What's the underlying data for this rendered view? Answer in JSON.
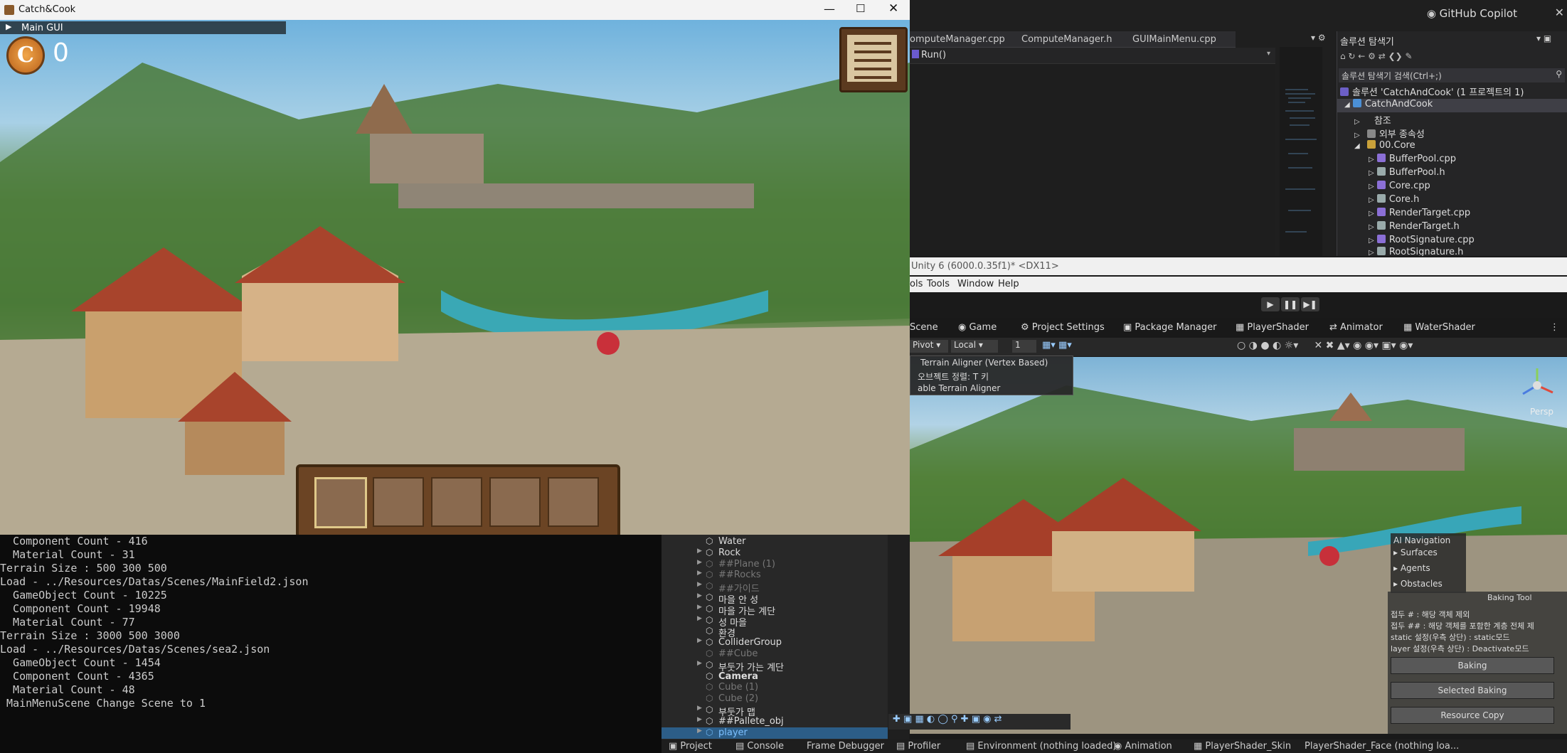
{
  "game_window": {
    "title": "Catch&Cook",
    "main_gui_label": "Main GUI",
    "coin_count": "0"
  },
  "console": {
    "lines": [
      "  Component Count - 416",
      "  Material Count - 31",
      "Terrain Size : 500 300 500",
      "Load - ../Resources/Datas/Scenes/MainField2.json",
      "  GameObject Count - 10225",
      "  Component Count - 19948",
      "  Material Count - 77",
      "Terrain Size : 3000 500 3000",
      "Load - ../Resources/Datas/Scenes/sea2.json",
      "  GameObject Count - 1454",
      "  Component Count - 4365",
      "  Material Count - 48",
      " MainMenuScene Change Scene to 1"
    ]
  },
  "hierarchy": {
    "items": [
      {
        "label": "Water",
        "dim": false,
        "arrow": false
      },
      {
        "label": "Rock",
        "dim": false,
        "arrow": true
      },
      {
        "label": "##Plane (1)",
        "dim": true,
        "arrow": true
      },
      {
        "label": "##Rocks",
        "dim": true,
        "arrow": true
      },
      {
        "label": "##가이드",
        "dim": true,
        "arrow": true
      },
      {
        "label": "마을 안 성",
        "dim": false,
        "arrow": true
      },
      {
        "label": "마을 가는 계단",
        "dim": false,
        "arrow": true
      },
      {
        "label": "성 마을",
        "dim": false,
        "arrow": true
      },
      {
        "label": "환경",
        "dim": false,
        "arrow": false
      },
      {
        "label": "ColliderGroup",
        "dim": false,
        "arrow": true
      },
      {
        "label": "##Cube",
        "dim": true,
        "arrow": false
      },
      {
        "label": "부둣가 가는 계단",
        "dim": false,
        "arrow": true
      },
      {
        "label": "Camera",
        "dim": false,
        "arrow": false
      },
      {
        "label": "Cube (1)",
        "dim": true,
        "arrow": false
      },
      {
        "label": "Cube (2)",
        "dim": true,
        "arrow": false
      },
      {
        "label": "부둣가 맵",
        "dim": false,
        "arrow": true
      },
      {
        "label": "##Pallete_obj",
        "dim": false,
        "arrow": true
      },
      {
        "label": "player",
        "dim": false,
        "arrow": true,
        "selected": true
      }
    ]
  },
  "bottom_tabs": [
    "Project",
    "Console",
    "Frame Debugger",
    "Profiler",
    "Environment (nothing loaded)",
    "Animation",
    "PlayerShader_Skin",
    "PlayerShader_Face (nothing loa..."
  ],
  "vs": {
    "copilot": "GitHub Copilot",
    "tabs": [
      "omputeManager.cpp",
      "ComputeManager.h",
      "GUIMainMenu.cpp"
    ],
    "function": "Run()",
    "solution_explorer": {
      "title": "솔루션 탐색기",
      "search": "솔루션 탐색기 검색(Ctrl+;)",
      "solution": "솔루션 'CatchAndCook' (1 프로젝트의 1)",
      "project": "CatchAndCook",
      "refs": "참조",
      "external": "외부 종속성",
      "folder": "00.Core",
      "files": [
        "BufferPool.cpp",
        "BufferPool.h",
        "Core.cpp",
        "Core.h",
        "RenderTarget.cpp",
        "RenderTarget.h",
        "RootSignature.cpp",
        "RootSignature.h"
      ]
    }
  },
  "unity": {
    "title": "Unity 6 (6000.0.35f1)* <DX11>",
    "menu": [
      "ols",
      "Tools",
      "Window",
      "Help"
    ],
    "tabs": [
      "Scene",
      "Game",
      "Project Settings",
      "Package Manager",
      "PlayerShader",
      "Animator",
      "WaterShader"
    ],
    "toolbar": {
      "pivot": "Pivot",
      "local": "Local",
      "snap": "1"
    },
    "overlay": {
      "title": "Terrain Aligner (Vertex Based)",
      "line1": "오브젝트 정렬: T 키",
      "line2": "able Terrain Aligner"
    },
    "persp": "Persp",
    "ai_nav": {
      "title": "AI Navigation",
      "items": [
        "Surfaces",
        "Agents",
        "Obstacles"
      ]
    },
    "baking_tool": "Baking Tool",
    "notes": [
      "접두 # : 해당 객체 제외",
      "접두 ## : 해당 객체를 포함한 계층 전체 제",
      "static 설정(우측 상단) : static모드",
      "layer 설정(우측 상단) : Deactivate모드"
    ],
    "buttons": {
      "baking": "Baking",
      "selected": "Selected Baking",
      "resource": "Resource Copy"
    }
  }
}
